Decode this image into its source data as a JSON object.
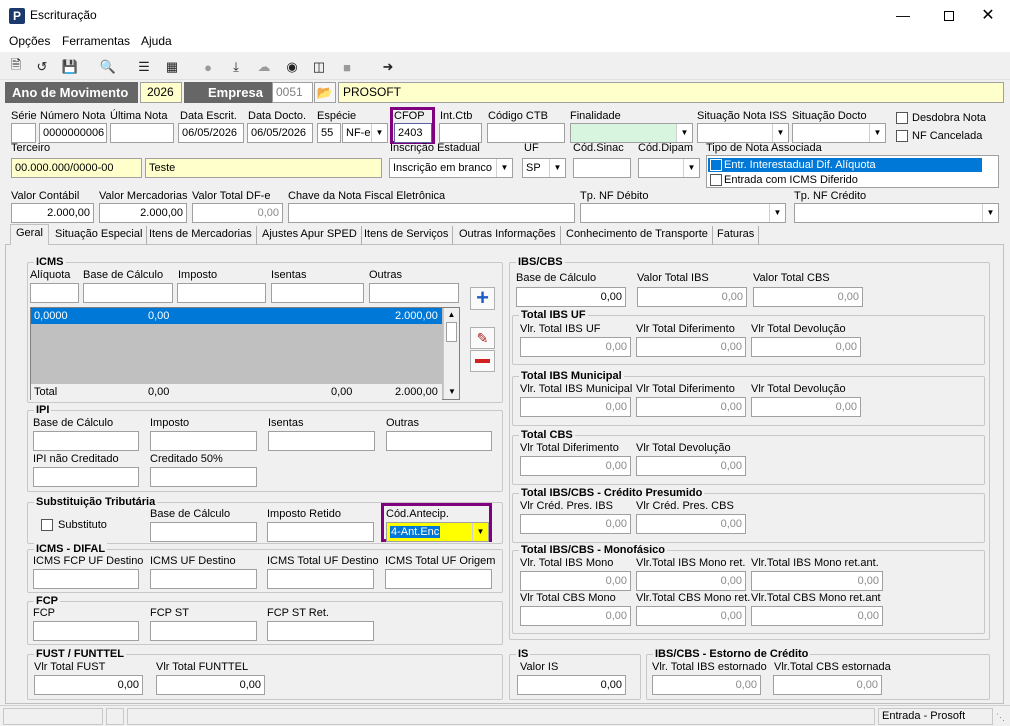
{
  "window": {
    "title": "Escrituração",
    "app_icon": "P"
  },
  "menu": [
    "Opções",
    "Ferramentas",
    "Ajuda"
  ],
  "header": {
    "ano_label": "Ano de Movimento",
    "ano_value": "2026",
    "empresa_label": "Empresa",
    "empresa_code": "0051",
    "empresa_name": "PROSOFT"
  },
  "doc": {
    "serie_label": "Série",
    "serie_value": "",
    "numero_label": "Número Nota",
    "numero_value": "0000000006",
    "ultima_label": "Última Nota",
    "ultima_value": "",
    "data_escrit_label": "Data Escrit.",
    "data_escrit_value": "06/05/2026",
    "data_docto_label": "Data Docto.",
    "data_docto_value": "06/05/2026",
    "especie_label": "Espécie",
    "especie_code": "55",
    "especie_value": "NF-e",
    "cfop_label": "CFOP",
    "cfop_value": "2403",
    "intctb_label": "Int.Ctb",
    "intctb_value": "",
    "codctb_label": "Código CTB",
    "codctb_value": "",
    "finalidade_label": "Finalidade",
    "finalidade_value": "",
    "situacao_iss_label": "Situação Nota ISS",
    "situacao_iss_value": "",
    "situacao_docto_label": "Situação Docto",
    "situacao_docto_value": "",
    "desdobra_label": "Desdobra Nota",
    "nf_cancelada_label": "NF Cancelada",
    "terceiro_label": "Terceiro",
    "terceiro_cnpj": "00.000.000/0000-00",
    "terceiro_nome": "Teste",
    "inscricao_label": "Inscrição Estadual",
    "inscricao_value": "Inscrição em branco",
    "uf_label": "UF",
    "uf_value": "SP",
    "codsinac_label": "Cód.Sinac",
    "codsinac_value": "",
    "coddipam_label": "Cód.Dipam",
    "coddipam_value": "",
    "tipo_nota_label": "Tipo de Nota Associada",
    "tipo_nota_items": [
      "Entr. Interestadual Dif. Alíquota",
      "Entrada com ICMS Diferido"
    ],
    "valor_contabil_label": "Valor Contábil",
    "valor_contabil_value": "2.000,00",
    "valor_merc_label": "Valor Mercadorias",
    "valor_merc_value": "2.000,00",
    "valor_dfe_label": "Valor Total DF-e",
    "valor_dfe_value": "0,00",
    "chave_label": "Chave da Nota Fiscal Eletrônica",
    "chave_value": "",
    "tp_debito_label": "Tp. NF Débito",
    "tp_debito_value": "",
    "tp_credito_label": "Tp. NF Crédito",
    "tp_credito_value": ""
  },
  "tabs": [
    "Geral",
    "Situação Especial",
    "Itens de Mercadorias",
    "Ajustes Apur SPED",
    "Itens de Serviços",
    "Outras Informações",
    "Conhecimento de Transporte",
    "Faturas"
  ],
  "icms": {
    "title": "ICMS",
    "cols": [
      "Alíquota",
      "Base de Cálculo",
      "Imposto",
      "Isentas",
      "Outras"
    ],
    "row": [
      "0,0000",
      "0,00",
      "",
      "",
      "2.000,00"
    ],
    "total_label": "Total",
    "total_row": [
      "0,00",
      "",
      "0,00",
      "2.000,00"
    ]
  },
  "ipi": {
    "title": "IPI",
    "labels": [
      "Base de Cálculo",
      "Imposto",
      "Isentas",
      "Outras"
    ],
    "labels2": [
      "IPI não Creditado",
      "Creditado 50%"
    ]
  },
  "st": {
    "title": "Substituição Tributária",
    "substituto_label": "Substituto",
    "labels": [
      "Base de Cálculo",
      "Imposto Retido",
      "Cód.Antecip."
    ],
    "cod_antecip_value": "4-Ant.Enc"
  },
  "difal": {
    "title": "ICMS - DIFAL",
    "labels": [
      "ICMS FCP UF Destino",
      "ICMS UF Destino",
      "ICMS Total UF Destino",
      "ICMS Total UF Origem"
    ]
  },
  "fcp": {
    "title": "FCP",
    "labels": [
      "FCP",
      "FCP ST",
      "FCP ST Ret."
    ]
  },
  "fust": {
    "title": "FUST / FUNTTEL",
    "labels": [
      "Vlr Total FUST",
      "Vlr Total FUNTTEL"
    ],
    "values": [
      "0,00",
      "0,00"
    ]
  },
  "ibscbs": {
    "title": "IBS/CBS",
    "labels": [
      "Base de Cálculo",
      "Valor Total IBS",
      "Valor Total CBS"
    ],
    "values": [
      "0,00",
      "0,00",
      "0,00"
    ]
  },
  "ibs_uf": {
    "title": "Total IBS UF",
    "labels": [
      "Vlr. Total IBS UF",
      "Vlr Total Diferimento",
      "Vlr Total Devolução"
    ],
    "values": [
      "0,00",
      "0,00",
      "0,00"
    ]
  },
  "ibs_mun": {
    "title": "Total IBS Municipal",
    "labels": [
      "Vlr. Total IBS Municipal",
      "Vlr Total Diferimento",
      "Vlr Total Devolução"
    ],
    "values": [
      "0,00",
      "0,00",
      "0,00"
    ]
  },
  "cbs": {
    "title": "Total CBS",
    "labels": [
      "Vlr Total Diferimento",
      "Vlr Total Devolução"
    ],
    "values": [
      "0,00",
      "0,00"
    ]
  },
  "cred_pres": {
    "title": "Total IBS/CBS - Crédito Presumido",
    "labels": [
      "Vlr Créd. Pres. IBS",
      "Vlr Créd. Pres. CBS"
    ],
    "values": [
      "0,00",
      "0,00"
    ]
  },
  "mono": {
    "title": "Total IBS/CBS - Monofásico",
    "labels": [
      "Vlr. Total IBS Mono",
      "Vlr.Total IBS Mono ret.",
      "Vlr.Total IBS Mono ret.ant.",
      "Vlr Total CBS Mono",
      "Vlr.Total CBS Mono ret.",
      "Vlr.Total CBS Mono ret.ant"
    ],
    "values": [
      "0,00",
      "0,00",
      "0,00",
      "0,00",
      "0,00",
      "0,00"
    ]
  },
  "is": {
    "title": "IS",
    "label": "Valor IS",
    "value": "0,00"
  },
  "estorno": {
    "title": "IBS/CBS - Estorno de Crédito",
    "labels": [
      "Vlr. Total IBS estornado",
      "Vlr.Total CBS estornada"
    ],
    "values": [
      "0,00",
      "0,00"
    ]
  },
  "status": {
    "right": "Entrada - Prosoft"
  },
  "colors": {
    "selection": "#0078d7",
    "yellow_field": "#ffffcc",
    "green_field": "#d8f5e0",
    "highlight_yellow": "#ffff00",
    "callout_border": "#800080"
  }
}
